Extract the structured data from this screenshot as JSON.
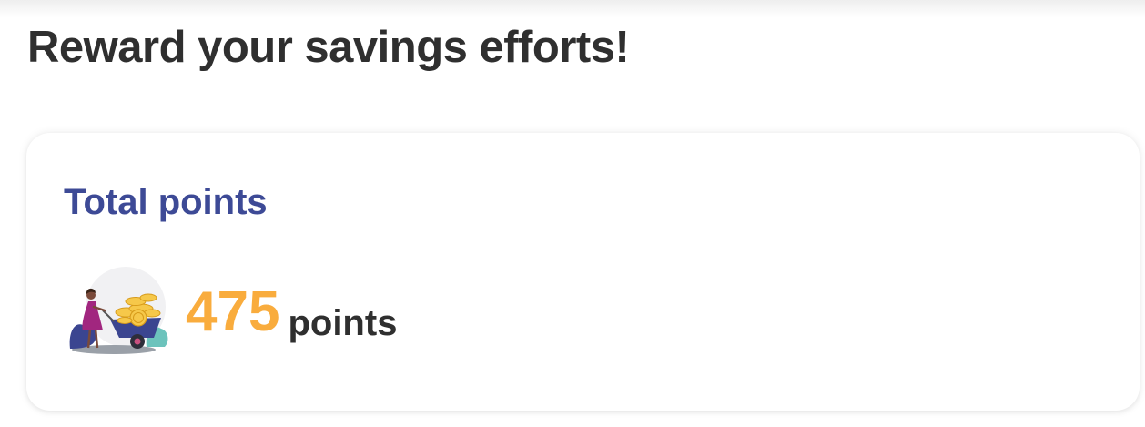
{
  "header": {
    "title": "Reward your savings efforts!"
  },
  "points_card": {
    "title": "Total points",
    "value": "475",
    "unit": "points",
    "illustration_icon": "woman-pushing-wheelbarrow-of-coins-icon"
  },
  "colors": {
    "title_text": "#2f2f2f",
    "card_title": "#3d4a96",
    "points_value": "#f9ac3d",
    "card_background": "#ffffff"
  }
}
